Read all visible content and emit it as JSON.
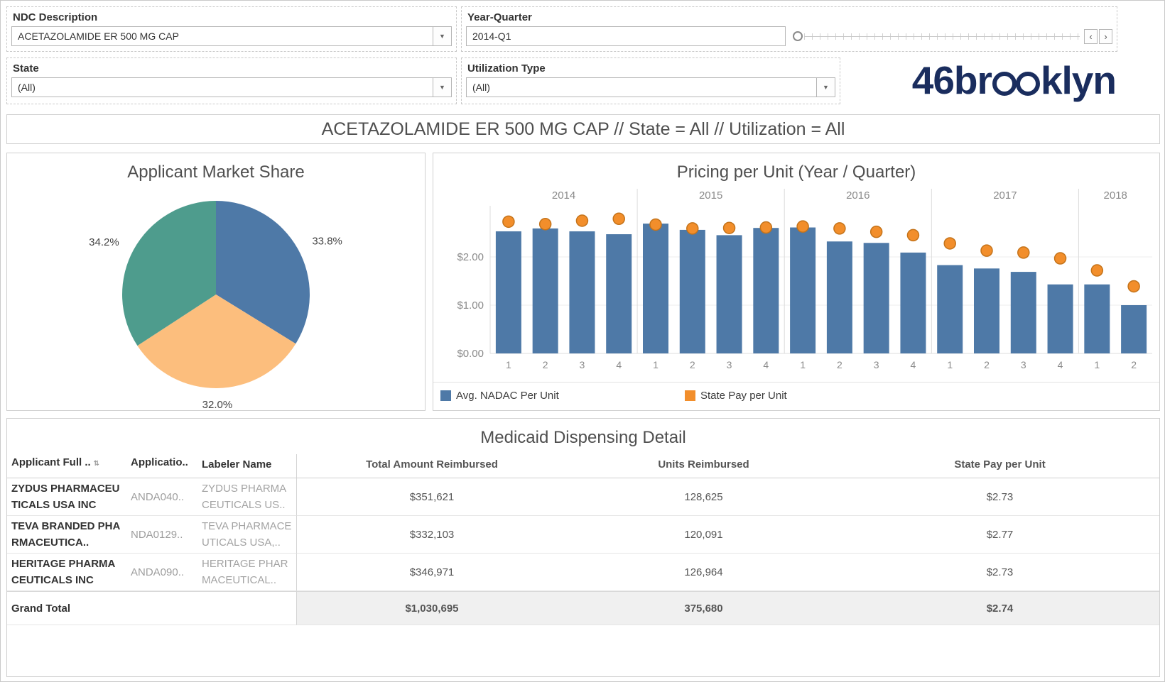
{
  "filters": {
    "ndc": {
      "label": "NDC Description",
      "value": "ACETAZOLAMIDE ER 500 MG CAP"
    },
    "year_quarter": {
      "label": "Year-Quarter",
      "value": "2014-Q1"
    },
    "state": {
      "label": "State",
      "value": "(All)"
    },
    "utilization": {
      "label": "Utilization Type",
      "value": "(All)"
    }
  },
  "logo": {
    "prefix": "46br",
    "suffix": "klyn",
    "color": "#1a2d5e"
  },
  "summary_title": "ACETAZOLAMIDE ER 500 MG CAP // State = All // Utilization = All",
  "chart_data": [
    {
      "type": "pie",
      "title": "Applicant Market Share",
      "values": [
        33.8,
        32.0,
        34.2
      ],
      "unit": "%",
      "colors": [
        "#4e79a7",
        "#fcbe7d",
        "#4e9c8d"
      ]
    },
    {
      "type": "bar",
      "title": "Pricing per Unit (Year / Quarter)",
      "groups": [
        {
          "year": "2014",
          "quarters": [
            "1",
            "2",
            "3",
            "4"
          ]
        },
        {
          "year": "2015",
          "quarters": [
            "1",
            "2",
            "3",
            "4"
          ]
        },
        {
          "year": "2016",
          "quarters": [
            "1",
            "2",
            "3",
            "4"
          ]
        },
        {
          "year": "2017",
          "quarters": [
            "1",
            "2",
            "3",
            "4"
          ]
        },
        {
          "year": "2018",
          "quarters": [
            "1",
            "2"
          ]
        }
      ],
      "series": [
        {
          "name": "Avg. NADAC Per Unit",
          "mark": "bar",
          "color": "#4e79a7",
          "values": [
            2.53,
            2.59,
            2.53,
            2.47,
            2.69,
            2.56,
            2.45,
            2.6,
            2.61,
            2.32,
            2.29,
            2.09,
            1.83,
            1.76,
            1.69,
            1.43,
            1.43,
            1.0
          ]
        },
        {
          "name": "State Pay per Unit",
          "mark": "circle",
          "color": "#f28e2b",
          "stroke": "#c4731a",
          "values": [
            2.73,
            2.68,
            2.75,
            2.79,
            2.67,
            2.59,
            2.6,
            2.61,
            2.63,
            2.59,
            2.52,
            2.45,
            2.28,
            2.13,
            2.09,
            1.97,
            1.72,
            1.39
          ]
        }
      ],
      "ylim": [
        0,
        3
      ],
      "yticks": [
        0,
        1,
        2
      ],
      "legend_position": "bottom"
    }
  ],
  "table": {
    "title": "Medicaid Dispensing Detail",
    "headers": [
      "Applicant Full ..",
      "Applicatio..",
      "Labeler Name",
      "Total Amount Reimbursed",
      "Units Reimbursed",
      "State Pay per Unit"
    ],
    "rows": [
      {
        "applicant": "ZYDUS PHARMACEUTICALS USA INC",
        "application": "ANDA040..",
        "labeler": "ZYDUS PHARMACEUTICALS US..",
        "total": "$351,621",
        "units": "128,625",
        "state_pay": "$2.73"
      },
      {
        "applicant": "TEVA BRANDED PHARMACEUTICA..",
        "application": "NDA0129..",
        "labeler": "TEVA PHARMACEUTICALS USA,..",
        "total": "$332,103",
        "units": "120,091",
        "state_pay": "$2.77"
      },
      {
        "applicant": "HERITAGE PHARMACEUTICALS INC",
        "application": "ANDA090..",
        "labeler": "HERITAGE PHARMACEUTICAL..",
        "total": "$346,971",
        "units": "126,964",
        "state_pay": "$2.73"
      }
    ],
    "grand_total": {
      "label": "Grand Total",
      "total": "$1,030,695",
      "units": "375,680",
      "state_pay": "$2.74"
    }
  }
}
